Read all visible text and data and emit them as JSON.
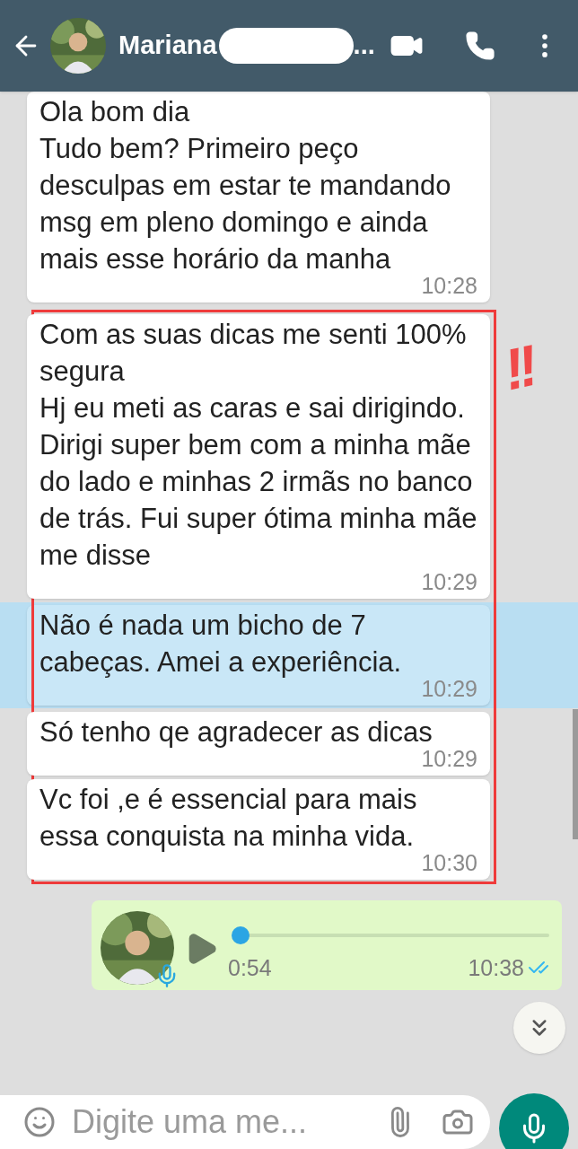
{
  "header": {
    "name": "Mariana",
    "name_suffix": "...",
    "name_redacted": true
  },
  "messages": [
    {
      "kind": "text",
      "selected": false,
      "text": "Ola bom dia\n Tudo bem? Primeiro peço desculpas em estar te mandando msg em pleno domingo e ainda mais esse horário da manha",
      "time": "10:28"
    },
    {
      "kind": "annotated_group",
      "mark": "!!",
      "messages": [
        {
          "kind": "text",
          "selected": false,
          "text": "Com as suas dicas me senti 100% segura\nHj eu meti as caras e sai dirigindo. Dirigi super bem com a minha mãe do lado e minhas 2 irmãs no banco de trás. Fui super ótima minha mãe me disse",
          "time": "10:29"
        },
        {
          "kind": "text",
          "selected": true,
          "text": "Não é nada um bicho de 7 cabeças. Amei a experiência.",
          "time": "10:29"
        },
        {
          "kind": "text",
          "selected": false,
          "text": "Só tenho qe agradecer as dicas",
          "time": "10:29"
        },
        {
          "kind": "text",
          "selected": false,
          "text": "Vc foi ,e é essencial para mais essa conquista na minha vida.",
          "time": "10:30"
        }
      ]
    },
    {
      "kind": "voice",
      "selected": false,
      "duration": "0:54",
      "time": "10:38",
      "level": 0,
      "read": true
    }
  ],
  "composer": {
    "placeholder": "Digite uma me..."
  }
}
